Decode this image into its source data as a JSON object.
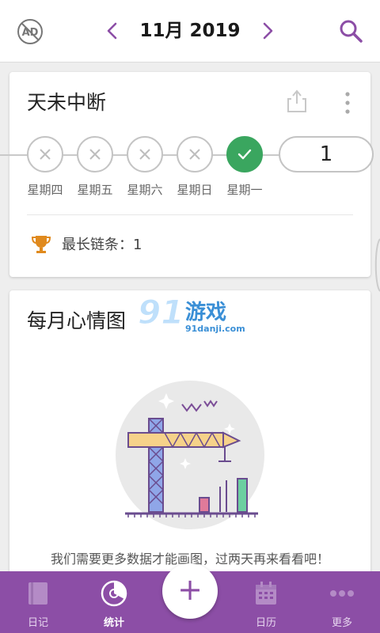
{
  "header": {
    "month_title": "11月 2019",
    "ad_icon": "ad-blocked-icon",
    "prev_icon": "chevron-left-icon",
    "next_icon": "chevron-right-icon",
    "search_icon": "search-icon"
  },
  "streak_card": {
    "title": "天未中断",
    "days": [
      {
        "label": "星期四",
        "status": "missed"
      },
      {
        "label": "星期五",
        "status": "missed"
      },
      {
        "label": "星期六",
        "status": "missed"
      },
      {
        "label": "星期日",
        "status": "missed"
      },
      {
        "label": "星期一",
        "status": "done"
      }
    ],
    "current_streak": "1",
    "longest_label": "最长链条：1"
  },
  "mood_card": {
    "title": "每月心情图",
    "watermark": "91danji.com",
    "message": "我们需要更多数据才能画图，过两天再来看看吧！"
  },
  "bottom_nav": {
    "items": [
      {
        "label": "日记",
        "icon": "diary-book-icon"
      },
      {
        "label": "统计",
        "icon": "stats-disc-icon"
      },
      {
        "label": "日历",
        "icon": "calendar-icon"
      },
      {
        "label": "更多",
        "icon": "more-dots-icon"
      }
    ],
    "active_index": 1,
    "fab_label": "+"
  },
  "colors": {
    "accent": "#8c4ea6",
    "done_green": "#3aa65f",
    "trophy": "#e08a1e"
  }
}
